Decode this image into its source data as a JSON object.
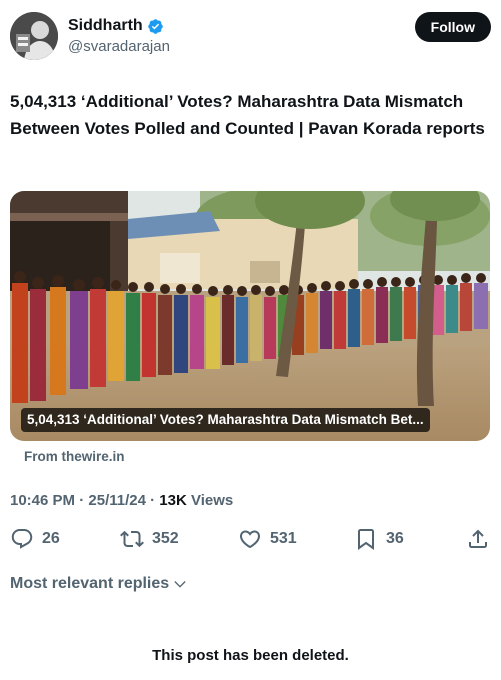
{
  "author": {
    "display_name": "Siddharth",
    "handle": "@svaradarajan",
    "verified_color": "#1d9bf0"
  },
  "follow_button": {
    "label": "Follow"
  },
  "tweet": {
    "text": "5,04,313 ‘Additional’ Votes? Maharashtra Data Mismatch Between Votes Polled and Counted | Pavan Korada reports"
  },
  "link_card": {
    "caption": "5,04,313 ‘Additional’ Votes? Maharashtra Data Mismatch Bet...",
    "source": "From thewire.in"
  },
  "meta": {
    "time": "10:46 PM",
    "date": "25/11/24",
    "views_count": "13K",
    "views_label": "Views"
  },
  "actions": {
    "reply": {
      "icon": "reply-icon",
      "count": "26"
    },
    "repost": {
      "icon": "repost-icon",
      "count": "352"
    },
    "like": {
      "icon": "heart-icon",
      "count": "531"
    },
    "bookmark": {
      "icon": "bookmark-icon",
      "count": "36"
    },
    "share": {
      "icon": "share-icon"
    }
  },
  "replies": {
    "sort_label": "Most relevant replies"
  },
  "deleted_notice": "This post has been deleted."
}
